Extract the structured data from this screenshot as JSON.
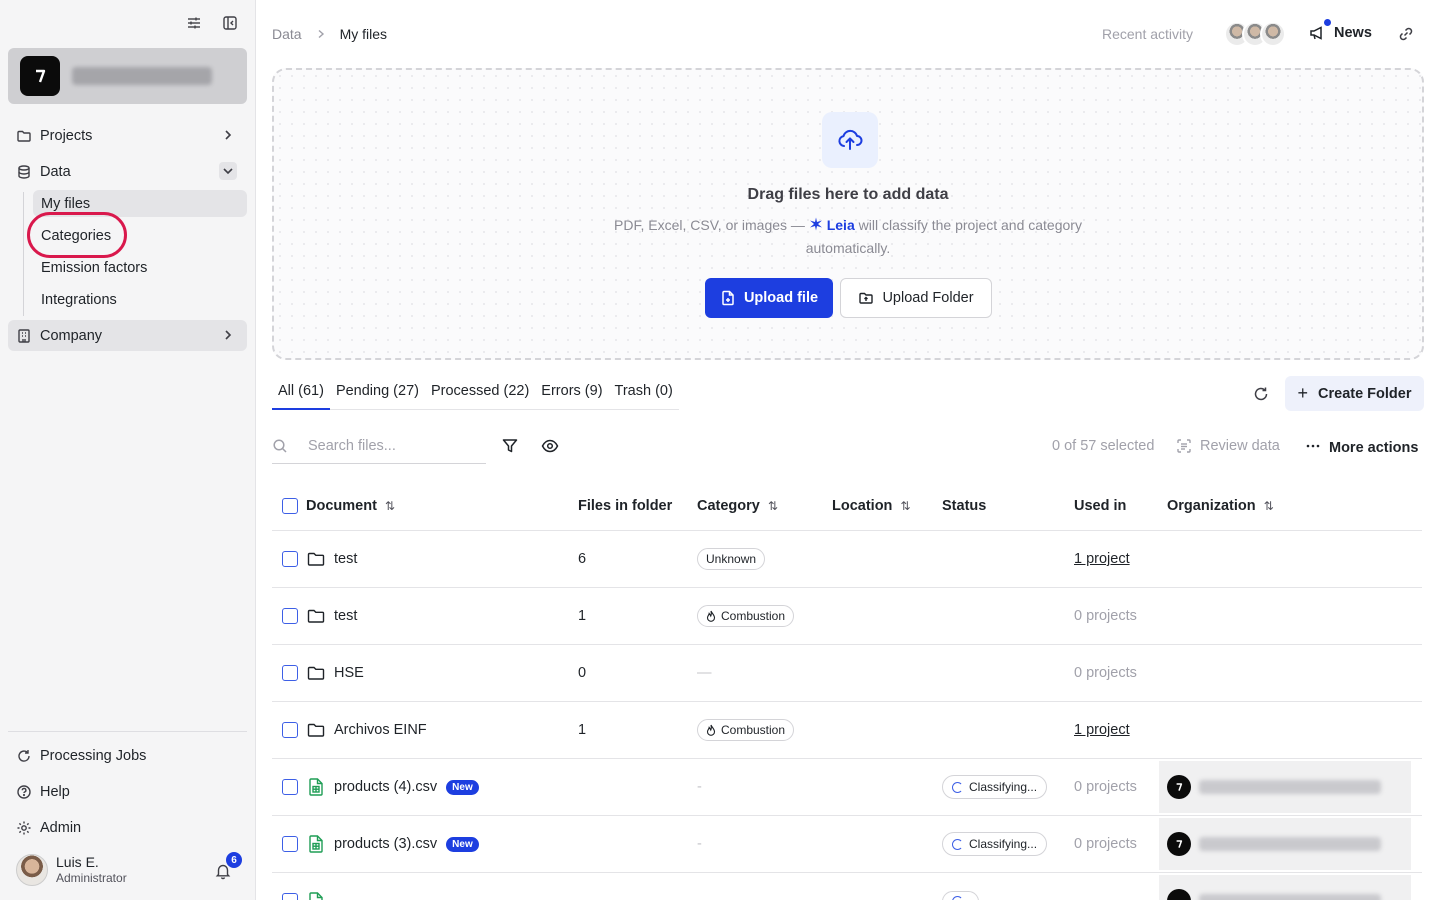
{
  "sidebar": {
    "nav": {
      "projects": "Projects",
      "data": "Data",
      "company": "Company"
    },
    "data_sub": {
      "my_files": "My files",
      "categories": "Categories",
      "emission_factors": "Emission factors",
      "integrations": "Integrations"
    },
    "bottom": {
      "processing_jobs": "Processing Jobs",
      "help": "Help",
      "admin": "Admin"
    },
    "user": {
      "name": "Luis E.",
      "role": "Administrator",
      "notifications": "6"
    }
  },
  "header": {
    "breadcrumb_root": "Data",
    "breadcrumb_current": "My files",
    "recent_activity": "Recent activity",
    "news": "News"
  },
  "dropzone": {
    "title": "Drag files here to add data",
    "desc_prefix": "PDF, Excel, CSV, or images —",
    "leia": "Leia",
    "desc_suffix": "will classify the project and category automatically.",
    "upload_file": "Upload file",
    "upload_folder": "Upload Folder"
  },
  "tabs": {
    "all": "All (61)",
    "pending": "Pending (27)",
    "processed": "Processed (22)",
    "errors": "Errors (9)",
    "trash": "Trash (0)"
  },
  "actions": {
    "create_folder": "Create Folder"
  },
  "toolbar": {
    "search_placeholder": "Search files...",
    "selected": "0 of 57 selected",
    "review_data": "Review data",
    "more_actions": "More actions"
  },
  "table": {
    "headers": {
      "document": "Document",
      "files_in_folder": "Files in folder",
      "category": "Category",
      "location": "Location",
      "status": "Status",
      "used_in": "Used in",
      "organization": "Organization"
    },
    "rows": [
      {
        "name": "test",
        "files": "6",
        "category": "Unknown",
        "used_in": "1 project"
      },
      {
        "name": "test",
        "files": "1",
        "category": "Combustion",
        "used_in": "0 projects"
      },
      {
        "name": "HSE",
        "files": "0",
        "category": "—",
        "used_in": "0 projects"
      },
      {
        "name": "Archivos EINF",
        "files": "1",
        "category": "Combustion",
        "used_in": "1 project"
      },
      {
        "name": "products (4).csv",
        "badge": "New",
        "category": "-",
        "status": "Classifying...",
        "used_in": "0 projects"
      },
      {
        "name": "products (3).csv",
        "badge": "New",
        "category": "-",
        "status": "Classifying...",
        "used_in": "0 projects"
      }
    ]
  }
}
